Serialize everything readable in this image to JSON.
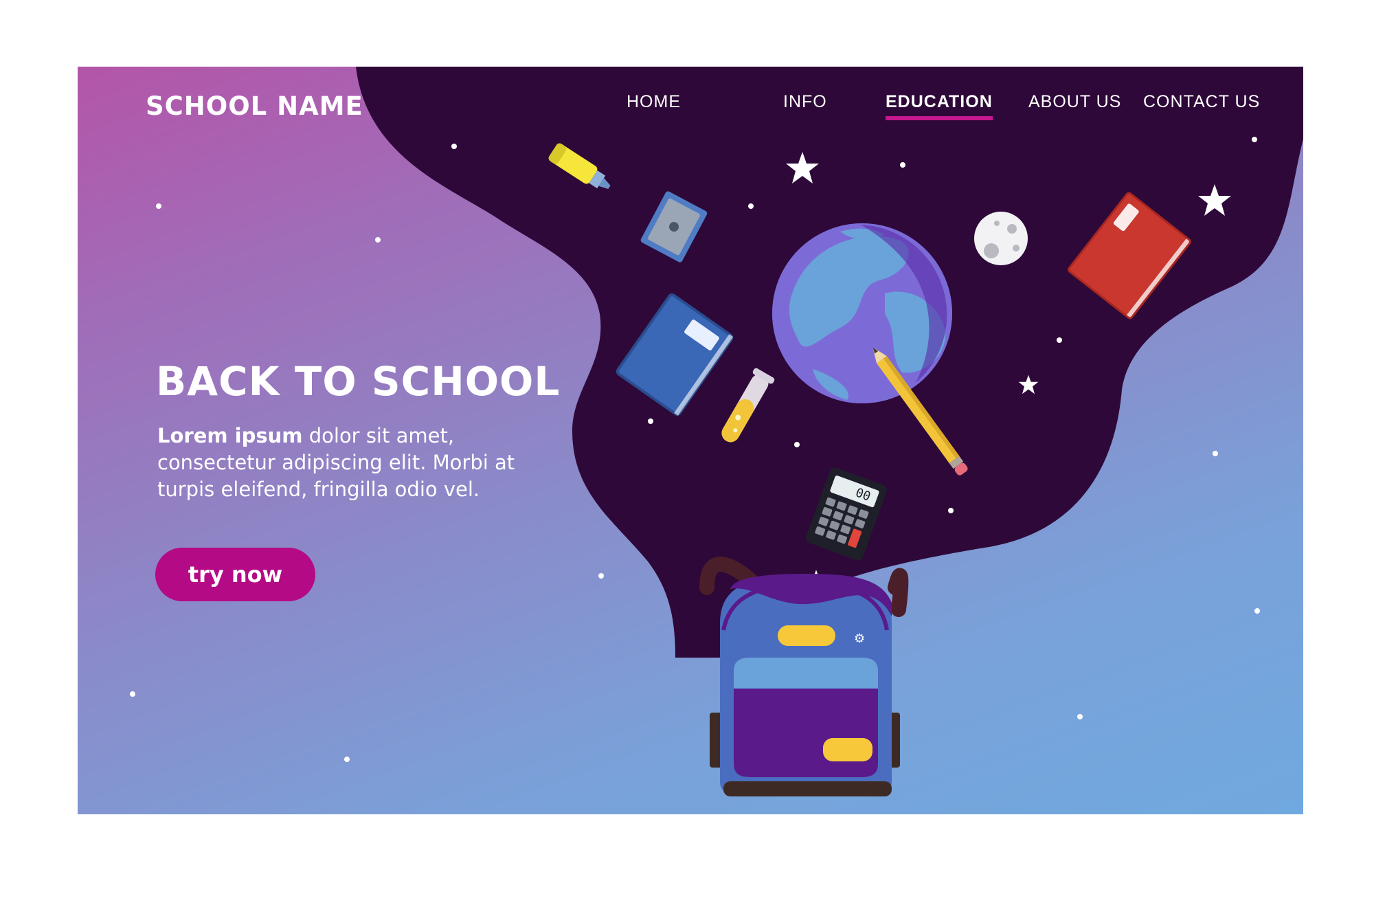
{
  "brand": {
    "name": "SCHOOL NAME"
  },
  "nav": {
    "items": [
      {
        "label": "HOME"
      },
      {
        "label": "INFO"
      },
      {
        "label": "EDUCATION",
        "active": true
      },
      {
        "label": "ABOUT US"
      },
      {
        "label": "CONTACT US"
      }
    ]
  },
  "hero": {
    "title": "BACK TO SCHOOL",
    "body_bold": "Lorem ipsum",
    "body_rest": " dolor sit amet, consectetur adipiscing elit. Morbi at turpis eleifend, fringilla odio vel.",
    "cta": "try now"
  },
  "calculator": {
    "display": "00"
  },
  "colors": {
    "space": "#2e0838",
    "accent": "#b40a86",
    "gradient_start": "#b455a8",
    "gradient_end": "#6fa9df"
  },
  "illustration": {
    "icons": [
      "highlighter-icon",
      "sharpener-icon",
      "notebook-icon",
      "test-tube-icon",
      "globe-icon",
      "moon-icon",
      "book-icon",
      "pencil-icon",
      "calculator-icon",
      "backpack-icon",
      "star-icon"
    ]
  }
}
